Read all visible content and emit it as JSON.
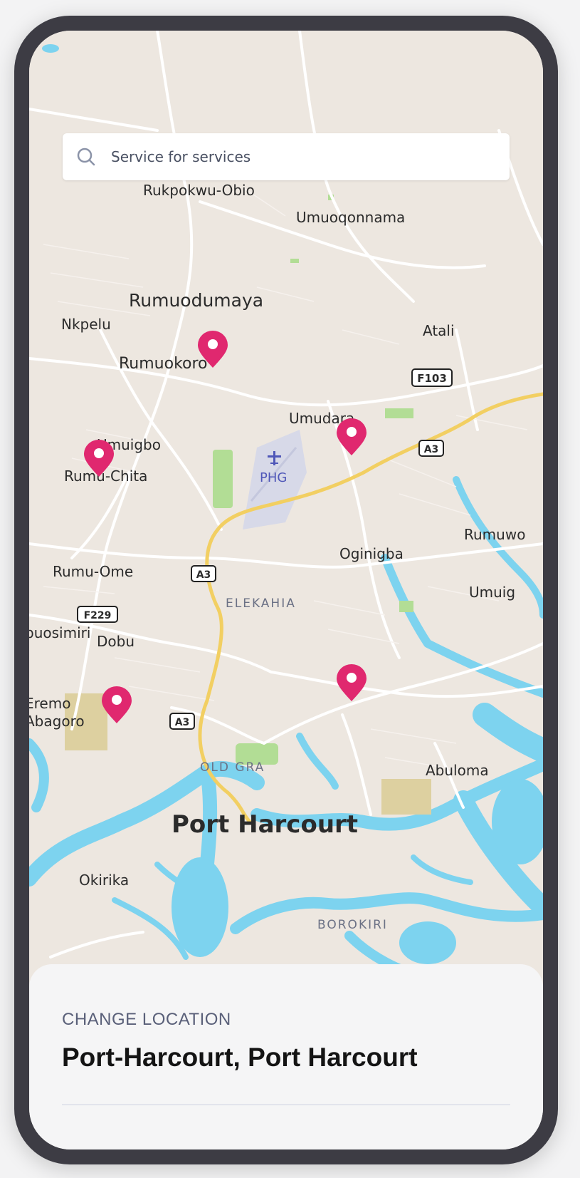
{
  "search": {
    "placeholder": "Service for services"
  },
  "map": {
    "places": [
      "Rukpokwu-Obio",
      "Umuoqonnama",
      "Rumuodumaya",
      "Nkpelu",
      "Atali",
      "Rumuokoro",
      "Umudara",
      "Umuigbo",
      "Rumu-Chita",
      "PHG",
      "Rumuwo",
      "Oginigba",
      "Rumu-Ome",
      "Umuig",
      "ELEKAHIA",
      "buosimiri",
      "Dobu",
      "Eremo",
      "Abagoro",
      "OLD GRA",
      "Abuloma",
      "Port Harcourt",
      "Okirika",
      "BOROKIRI"
    ],
    "road_shields": [
      "F103",
      "A3",
      "A3",
      "F229",
      "A3"
    ],
    "colors": {
      "land": "#ede7e0",
      "water": "#7dd3ef",
      "highway": "#f2cf62",
      "park": "#a8d88c",
      "pin": "#e0286f",
      "airport": "#d7d9e8"
    }
  },
  "location_sheet": {
    "label": "CHANGE LOCATION",
    "value": "Port-Harcourt, Port Harcourt"
  }
}
